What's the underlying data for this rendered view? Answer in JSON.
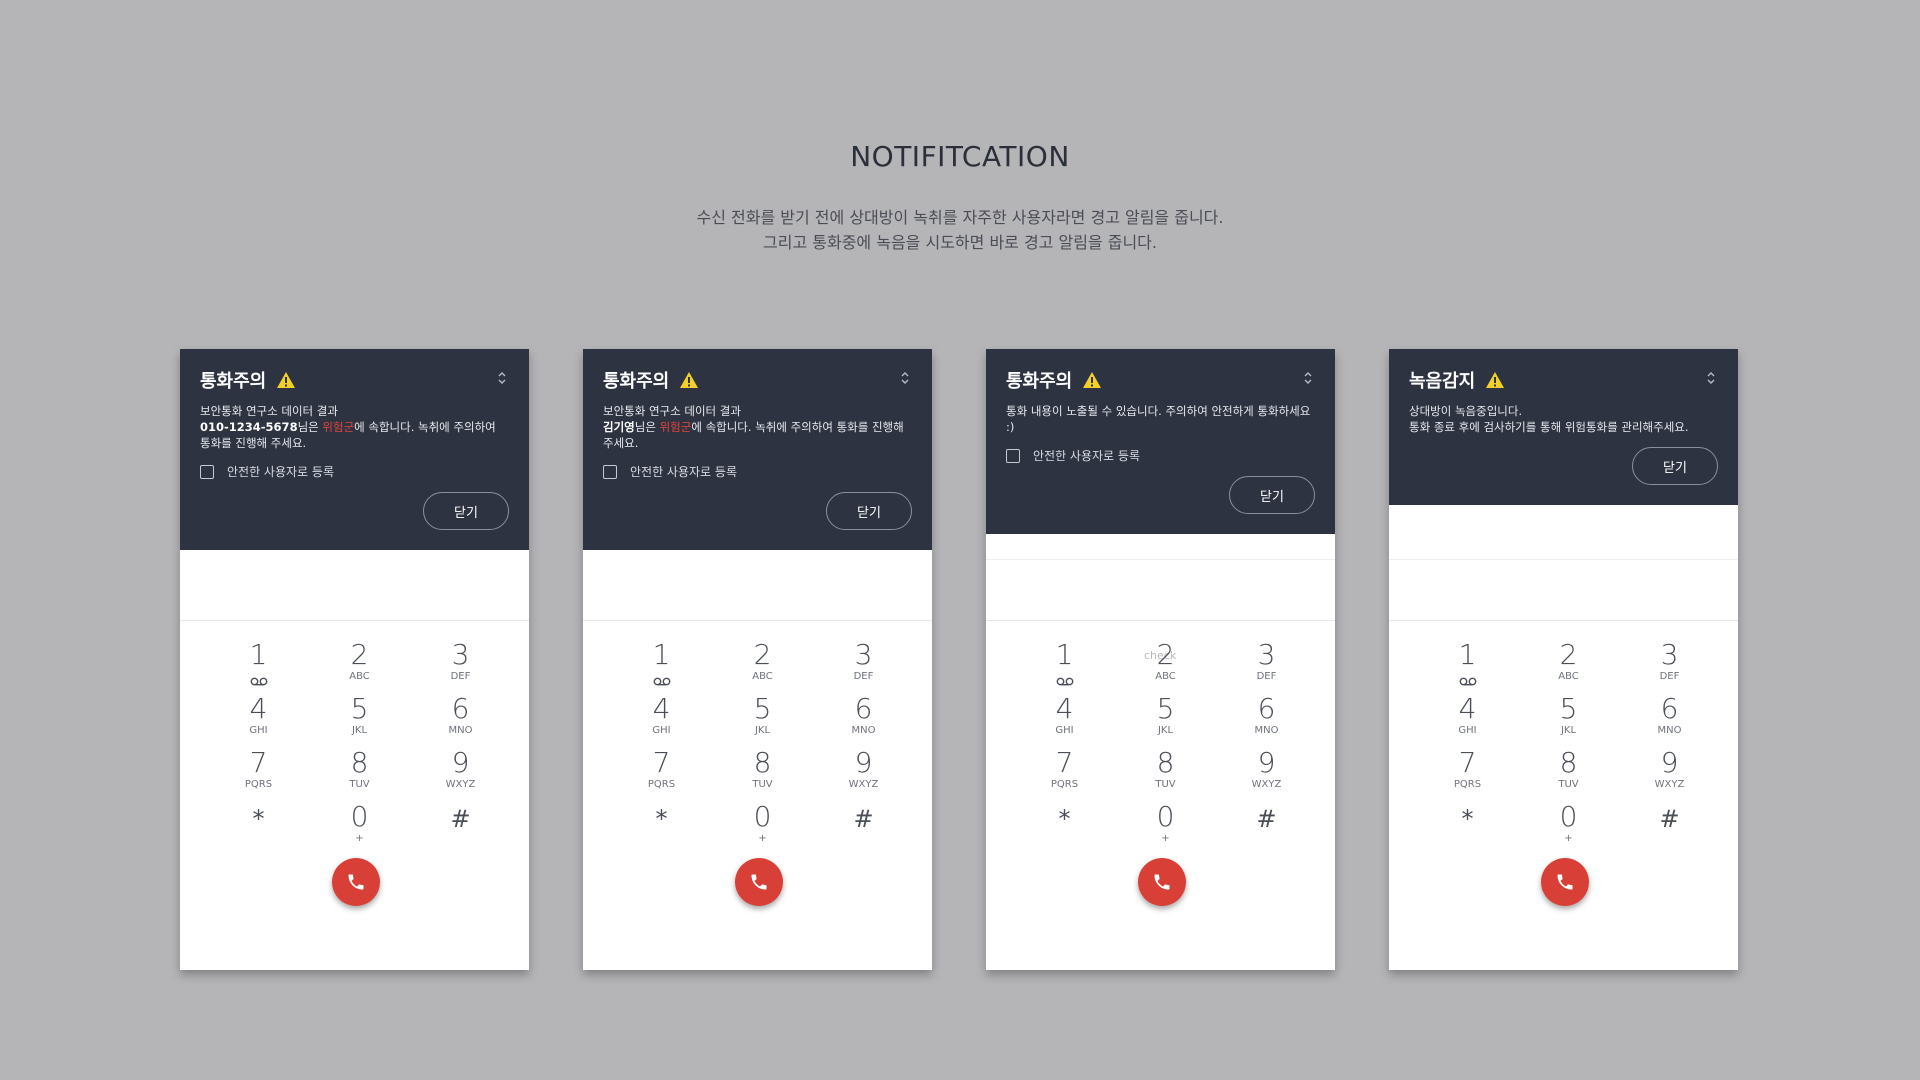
{
  "heading": "NOTIFITCATION",
  "description": [
    "수신 전화를 받기 전에 상대방이 녹취를 자주한 사용자라면 경고 알림을 줍니다.",
    "그리고 통화중에 녹음을 시도하면 바로 경고 알림을 줍니다."
  ],
  "phones": [
    {
      "title": "통화주의",
      "line1": "보안통화 연구소 데이터 결과",
      "caller": "010-1234-5678",
      "suffix1": "님은 ",
      "danger": "위험군",
      "suffix2": "에 속합니다. 녹취에 주의하여 통화를 진행해 주세요.",
      "checkbox_label": "안전한 사용자로 등록",
      "close_label": "닫기"
    },
    {
      "title": "통화주의",
      "line1": "보안통화 연구소 데이터 결과",
      "caller": "김기영",
      "suffix1": "님은 ",
      "danger": "위험군",
      "suffix2": "에 속합니다. 녹취에 주의하여 통화를 진행해 주세요.",
      "checkbox_label": "안전한 사용자로 등록",
      "close_label": "닫기"
    },
    {
      "title": "통화주의",
      "body": "통화 내용이 노출될 수 있습니다. 주의하여 안전하게 통화하세요 :)",
      "checkbox_label": "안전한 사용자로 등록",
      "close_label": "닫기",
      "watermark": "check"
    },
    {
      "title": "녹음감지",
      "line1": "상대방이 녹음중입니다.",
      "line2": "통화 종료 후에 검사하기를 통해 위험통화를 관리해주세요.",
      "close_label": "닫기"
    }
  ],
  "keypad": [
    {
      "num": "1",
      "sub": ""
    },
    {
      "num": "2",
      "sub": "ABC"
    },
    {
      "num": "3",
      "sub": "DEF"
    },
    {
      "num": "4",
      "sub": "GHI"
    },
    {
      "num": "5",
      "sub": "JKL"
    },
    {
      "num": "6",
      "sub": "MNO"
    },
    {
      "num": "7",
      "sub": "PQRS"
    },
    {
      "num": "8",
      "sub": "TUV"
    },
    {
      "num": "9",
      "sub": "WXYZ"
    },
    {
      "num": "*",
      "sub": ""
    },
    {
      "num": "0",
      "sub": "+"
    },
    {
      "num": "#",
      "sub": ""
    }
  ],
  "icons": {
    "warning": "warning-icon",
    "expand": "expand-icon",
    "voicemail": "voicemail-icon",
    "call": "phone-icon"
  },
  "colors": {
    "background": "#b5b5b8",
    "notification_bg": "#2e3341",
    "danger": "#e2443b",
    "call_button": "#d84037",
    "warning": "#f2d027"
  }
}
